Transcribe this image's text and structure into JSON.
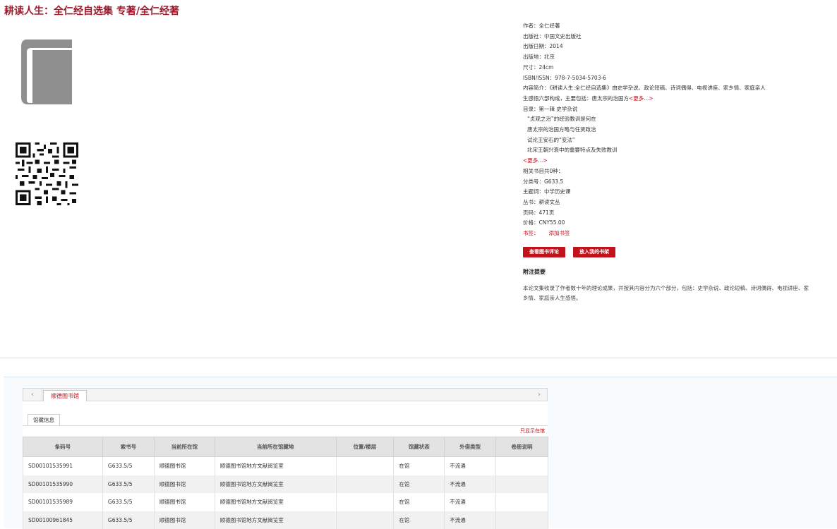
{
  "title": "耕读人生：全仁经自选集 专著/全仁经著",
  "cover_icon": "book-icon",
  "qr_icon": "qr-code-icon",
  "meta": {
    "author": "作者：全仁经著",
    "publisher": "出版社：中国文史出版社",
    "pub_date": "出版日期：2014",
    "pub_place": "出版地：北京",
    "size": "尺寸：24cm",
    "isbn": "ISBN/ISSN：978-7-5034-5703-6",
    "intro_line1": "内容简介：《耕读人生:全仁经自选集》由史学杂说、政论短稿、诗词偶得、电视讲座、家乡情、家庭亲人",
    "intro_line2_text": "生感悟六部构成，主要包括：唐太宗的治国方",
    "intro_more": "<更多...>",
    "toc_head": "目录：第一辑  史学杂说",
    "toc_items": [
      "“贞观之治”的经验教训是何在",
      "唐太宗的治国方略与任贤政治",
      "试论王安石的“变法”",
      "北宋王朝兴衰中的重要特点及失败教训"
    ],
    "toc_more": "<更多...>",
    "related_count": "相关书目共0种：",
    "class_no": "分类号：G633.5",
    "subject": "主题词：中学历史课",
    "series": "丛书：耕读文丛",
    "pages": "页码：471页",
    "price": "价格：CNY55.00",
    "tag_label": "书签：",
    "tag_link": "添加书签"
  },
  "buttons": {
    "review": "查看图书评论",
    "shelf": "放入我的书架"
  },
  "notes": {
    "heading": "附注提要",
    "text": "本论文集收录了作者数十年的理论成果，并按其内容分为六个部分，包括：史学杂说、政论短稿、诗词偶得、电视讲座、家乡情、家庭亲人生感悟。"
  },
  "library_tab": "顺德图书馆",
  "sub_tab": "馆藏信息",
  "show_library": "只显示在馆",
  "table": {
    "headers": [
      "条码号",
      "索书号",
      "当前所在馆",
      "当前所在馆藏地",
      "位置/楼层",
      "馆藏状态",
      "外借类型",
      "卷册说明"
    ],
    "rows": [
      [
        "SD00101535991",
        "G633.5/5",
        "顺德图书馆",
        "顺德图书馆地方文献阅览室",
        "",
        "在馆",
        "不流通",
        ""
      ],
      [
        "SD00101535990",
        "G633.5/5",
        "顺德图书馆",
        "顺德图书馆地方文献阅览室",
        "",
        "在馆",
        "不流通",
        ""
      ],
      [
        "SD00101535989",
        "G633.5/5",
        "顺德图书馆",
        "顺德图书馆地方文献阅览室",
        "",
        "在馆",
        "不流通",
        ""
      ],
      [
        "SD00100961845",
        "G633.5/5",
        "顺德图书馆",
        "顺德图书馆地方文献阅览室",
        "",
        "在馆",
        "不流通",
        ""
      ]
    ]
  }
}
